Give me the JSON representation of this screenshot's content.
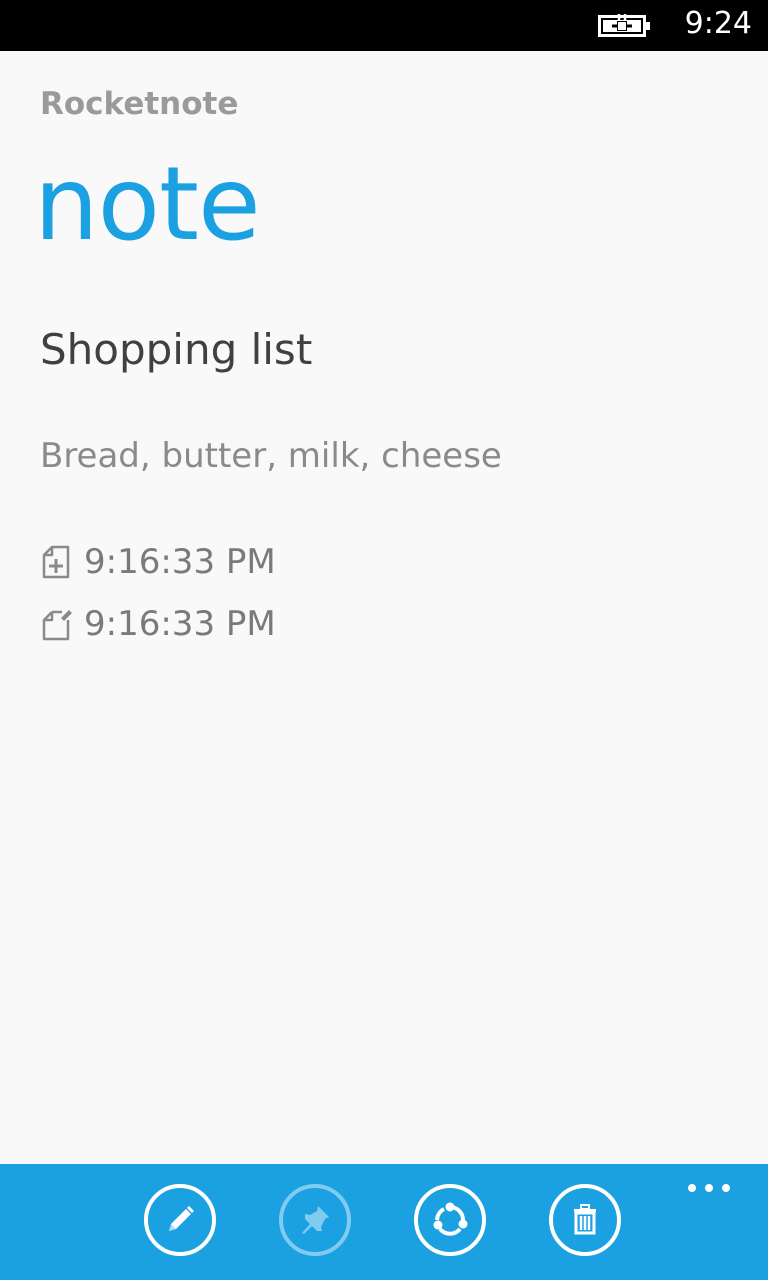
{
  "status_bar": {
    "time": "9:24",
    "battery_icon": "battery-charging-icon"
  },
  "header": {
    "app_name": "Rocketnote",
    "page_title": "note"
  },
  "note": {
    "title": "Shopping list",
    "body": "Bread, butter, milk, cheese",
    "created": {
      "icon": "note-created-icon",
      "time": "9:16:33 PM"
    },
    "modified": {
      "icon": "note-modified-icon",
      "time": "9:16:33 PM"
    }
  },
  "app_bar": {
    "background": "#1ba1e2",
    "buttons": [
      {
        "icon": "pencil-icon",
        "state": "enabled"
      },
      {
        "icon": "pin-icon",
        "state": "disabled"
      },
      {
        "icon": "sync-icon",
        "state": "enabled"
      },
      {
        "icon": "trash-icon",
        "state": "enabled"
      }
    ],
    "more_icon": "ellipsis-icon"
  },
  "colors": {
    "accent": "#1ba1e2",
    "background": "#f9f9f9"
  }
}
